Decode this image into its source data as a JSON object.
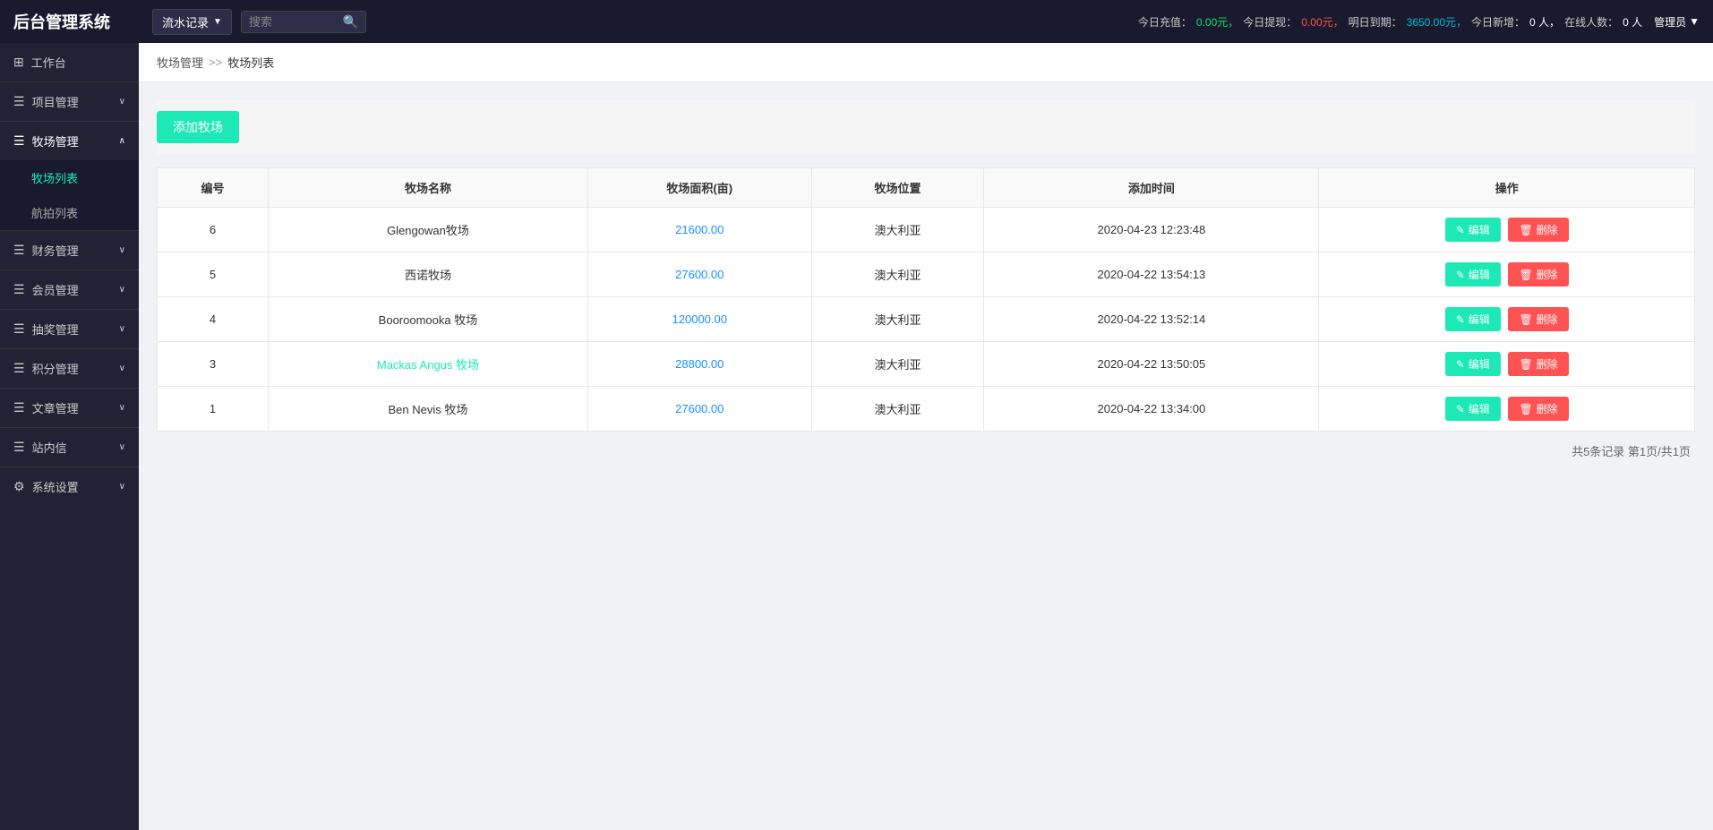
{
  "header": {
    "logo": "后台管理系统",
    "nav_dropdown_label": "流水记录",
    "search_placeholder": "搜索",
    "stats": {
      "recharge_label": "今日充值：",
      "recharge_value": "0.00元，",
      "withdraw_label": "今日提现：",
      "withdraw_value": "0.00元，",
      "expire_label": "明日到期：",
      "expire_value": "3650.00元，",
      "new_label": "今日新增：",
      "new_value": "0 人，",
      "online_label": "在线人数：",
      "online_value": "0 人",
      "user_label": "管理员"
    }
  },
  "sidebar": {
    "items": [
      {
        "id": "dashboard",
        "icon": "⊞",
        "label": "工作台",
        "expandable": false
      },
      {
        "id": "project",
        "icon": "☰",
        "label": "项目管理",
        "expandable": true
      },
      {
        "id": "pasture",
        "icon": "☰",
        "label": "牧场管理",
        "expandable": true,
        "expanded": true,
        "children": [
          {
            "id": "pasture-list",
            "label": "牧场列表",
            "active": true
          },
          {
            "id": "ranch-list",
            "label": "航拍列表"
          }
        ]
      },
      {
        "id": "finance",
        "icon": "☰",
        "label": "财务管理",
        "expandable": true
      },
      {
        "id": "member",
        "icon": "☰",
        "label": "会员管理",
        "expandable": true
      },
      {
        "id": "lottery",
        "icon": "☰",
        "label": "抽奖管理",
        "expandable": true
      },
      {
        "id": "points",
        "icon": "☰",
        "label": "积分管理",
        "expandable": true
      },
      {
        "id": "article",
        "icon": "☰",
        "label": "文章管理",
        "expandable": true
      },
      {
        "id": "message",
        "icon": "☰",
        "label": "站内信",
        "expandable": true
      },
      {
        "id": "settings",
        "icon": "⚙",
        "label": "系统设置",
        "expandable": true
      }
    ]
  },
  "breadcrumb": {
    "parent": "牧场管理",
    "separator": ">>",
    "current": "牧场列表"
  },
  "toolbar": {
    "add_button": "添加牧场"
  },
  "table": {
    "columns": [
      "编号",
      "牧场名称",
      "牧场面积(亩)",
      "牧场位置",
      "添加时间",
      "操作"
    ],
    "rows": [
      {
        "id": 6,
        "name": "Glengowan牧场",
        "area": "21600.00",
        "location": "澳大利亚",
        "time": "2020-04-23 12:23:48",
        "name_colored": false
      },
      {
        "id": 5,
        "name": "西诺牧场",
        "area": "27600.00",
        "location": "澳大利亚",
        "time": "2020-04-22 13:54:13",
        "name_colored": false
      },
      {
        "id": 4,
        "name": "Booroomooka 牧场",
        "area": "120000.00",
        "location": "澳大利亚",
        "time": "2020-04-22 13:52:14",
        "name_colored": false
      },
      {
        "id": 3,
        "name": "Mackas Angus 牧场",
        "area": "28800.00",
        "location": "澳大利亚",
        "time": "2020-04-22 13:50:05",
        "name_colored": true
      },
      {
        "id": 1,
        "name": "Ben Nevis 牧场",
        "area": "27600.00",
        "location": "澳大利亚",
        "time": "2020-04-22 13:34:00",
        "name_colored": false
      }
    ],
    "actions": {
      "edit_label": "编辑",
      "delete_label": "删除"
    }
  },
  "pagination": {
    "info": "共5条记录 第1页/共1页"
  }
}
